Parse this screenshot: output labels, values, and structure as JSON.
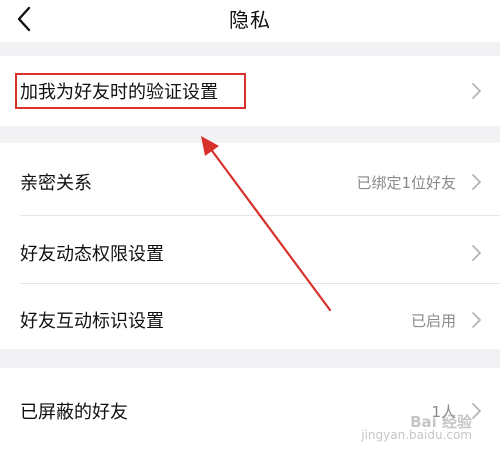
{
  "header": {
    "title": "隐私"
  },
  "sections": [
    {
      "rows": [
        {
          "label": "加我为好友时的验证设置",
          "value": ""
        }
      ]
    },
    {
      "rows": [
        {
          "label": "亲密关系",
          "value": "已绑定1位好友"
        },
        {
          "label": "好友动态权限设置",
          "value": ""
        },
        {
          "label": "好友互动标识设置",
          "value": "已启用"
        }
      ]
    },
    {
      "rows": [
        {
          "label": "已屏蔽的好友",
          "value": "1人"
        }
      ]
    }
  ],
  "watermark": {
    "main": "Bai 经验",
    "sub": "jingyan.baidu.com"
  },
  "colors": {
    "annotation_red": "#d9312c",
    "background": "#f2f2f4",
    "card": "#ffffff",
    "secondary_text": "#8a8a8e"
  },
  "icons": {
    "back": "chevron-left-icon",
    "row": "chevron-right-icon"
  }
}
